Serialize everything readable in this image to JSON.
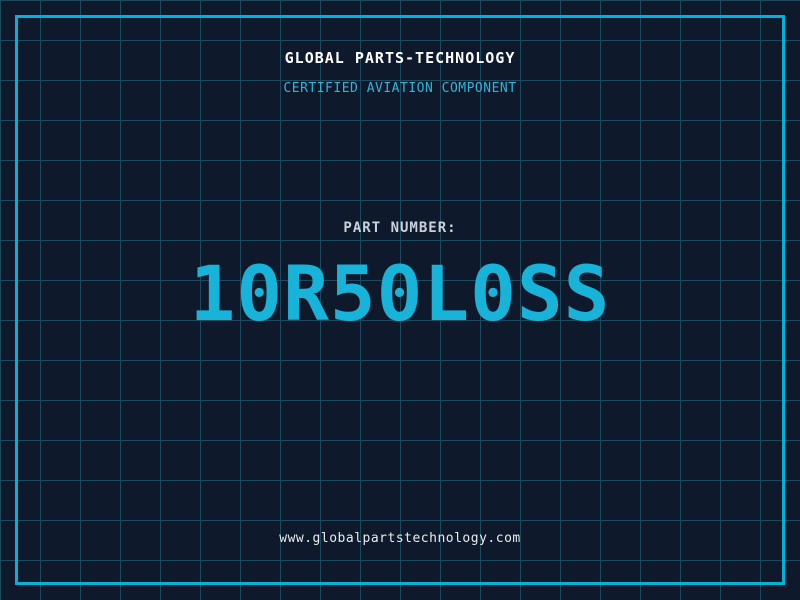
{
  "theme": {
    "background_color": "#0e1a2b",
    "grid_line_color": "#1d4a5f",
    "frame_color": "#00b2d8",
    "title_color": "#ffffff",
    "subtitle_color": "#2fb4da",
    "label_color": "#c9d2da",
    "part_number_color": "#17b3d8",
    "url_color": "#e8ecef"
  },
  "header": {
    "title": "GLOBAL PARTS-TECHNOLOGY",
    "subtitle": "CERTIFIED AVIATION COMPONENT"
  },
  "part": {
    "label": "PART NUMBER:",
    "number": "10R50L0SS"
  },
  "footer": {
    "url": "www.globalpartstechnology.com"
  }
}
